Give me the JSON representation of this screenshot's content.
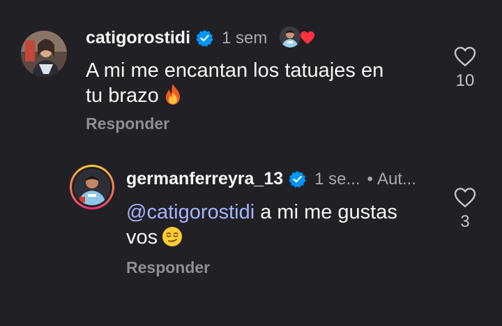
{
  "comments": [
    {
      "username": "catigorostidi",
      "time": "1 sem",
      "text_line1": "A mi me encantan los tatuajes en",
      "text_line2": "tu brazo",
      "emoji": "fire-emoji",
      "reply_label": "Responder",
      "likes": "10"
    },
    {
      "username": "germanferreyra_13",
      "time": "1 se...",
      "author_tag": "Aut...",
      "mention": "@catigorostidi",
      "text_rest": " a mi me gustas",
      "text_line2": "vos",
      "emoji": "smirking-face-emoji",
      "reply_label": "Responder",
      "likes": "3"
    }
  ],
  "colors": {
    "background": "#212125",
    "verified": "#0095f6",
    "mention": "#a7b4ff",
    "liked_heart": "#ff3040",
    "story_ring": "#fcd34d"
  }
}
